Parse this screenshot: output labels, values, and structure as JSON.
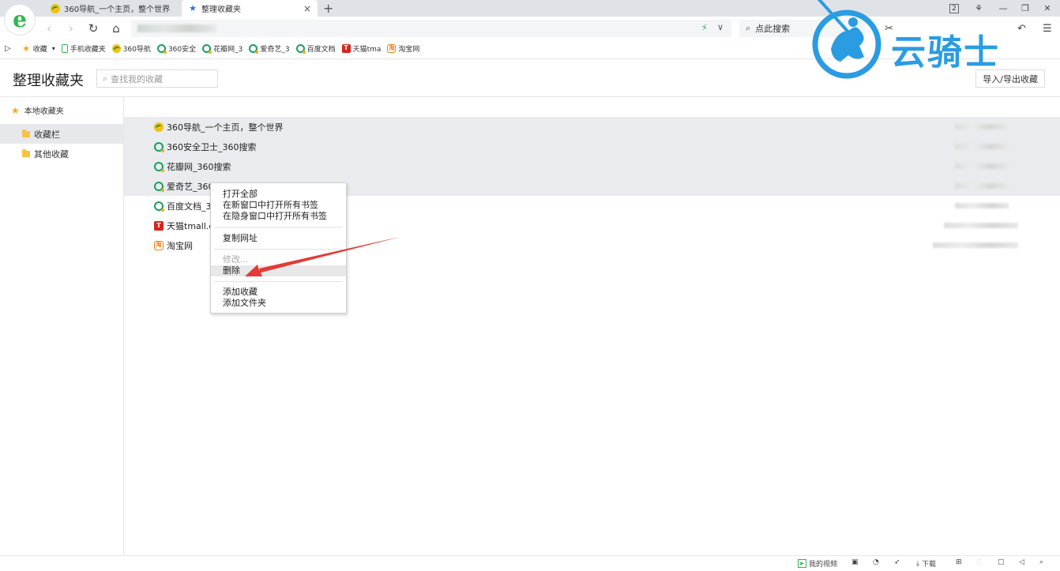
{
  "tabs": [
    {
      "label": "360导航_一个主页，整个世界",
      "icon": "360-nav-icon"
    },
    {
      "label": "整理收藏夹",
      "icon": "star-icon",
      "close": "×"
    }
  ],
  "new_tab": "+",
  "window_controls": {
    "tab_count": "2",
    "skin": "⚘",
    "minimize": "—",
    "restore": "❐",
    "close": "✕"
  },
  "nav": {
    "back": "‹",
    "forward": "›",
    "reload": "↻",
    "home": "⌂",
    "bolt": "⚡",
    "dropdown": "∨"
  },
  "search": {
    "placeholder": "点此搜索",
    "icon": "⌕"
  },
  "bookmarks_bar": {
    "toggle": "▷",
    "items": [
      {
        "label": "收藏",
        "icon": "star-icon",
        "suffix": "▾"
      },
      {
        "label": "手机收藏夹",
        "icon": "phone-icon"
      },
      {
        "label": "360导航",
        "icon": "360-nav-icon"
      },
      {
        "label": "360安全",
        "icon": "360-search-icon"
      },
      {
        "label": "花瓣网_3",
        "icon": "360-search-icon"
      },
      {
        "label": "爱奇艺_3",
        "icon": "360-search-icon"
      },
      {
        "label": "百度文档",
        "icon": "360-search-icon"
      },
      {
        "label": "天猫tma",
        "icon": "tmall-icon"
      },
      {
        "label": "淘宝网",
        "icon": "taobao-icon"
      }
    ]
  },
  "page": {
    "title": "整理收藏夹",
    "find_placeholder": "查找我的收藏",
    "import_export": "导入/导出收藏"
  },
  "sidebar": {
    "root": "本地收藏夹",
    "folders": [
      {
        "label": "收藏栏",
        "selected": true
      },
      {
        "label": "其他收藏",
        "selected": false
      }
    ]
  },
  "bookmarks": [
    {
      "title": "360导航_一个主页，整个世界",
      "icon": "360-nav-icon",
      "selected": true
    },
    {
      "title": "360安全卫士_360搜索",
      "icon": "360-search-icon",
      "selected": true
    },
    {
      "title": "花瓣网_360搜索",
      "icon": "360-search-icon",
      "selected": true
    },
    {
      "title": "爱奇艺_360",
      "icon": "360-search-icon",
      "selected": true
    },
    {
      "title": "百度文档_3",
      "icon": "360-search-icon",
      "selected": false
    },
    {
      "title": "天猫tmall.c",
      "icon": "tmall-icon",
      "selected": false
    },
    {
      "title": "淘宝网",
      "icon": "taobao-icon",
      "selected": false
    }
  ],
  "context_menu": {
    "items": [
      {
        "label": "打开全部",
        "disabled": false
      },
      {
        "label": "在新窗口中打开所有书签",
        "disabled": false
      },
      {
        "label": "在隐身窗口中打开所有书签",
        "disabled": false
      },
      {
        "label": "复制网址",
        "disabled": false
      },
      {
        "label": "修改...",
        "disabled": true
      },
      {
        "label": "删除",
        "disabled": false,
        "hover": true
      },
      {
        "label": "添加收藏",
        "disabled": false
      },
      {
        "label": "添加文件夹",
        "disabled": false
      }
    ]
  },
  "annotation": {
    "arrow_color": "#e53935"
  },
  "watermark": {
    "text": "云骑士",
    "color": "#2a9ce2"
  },
  "statusbar": {
    "my_video": "我的视频",
    "download": "下载"
  },
  "colors": {
    "accent_green": "#2eb84b",
    "selection": "#e9ebee",
    "folder": "#f6c343"
  }
}
